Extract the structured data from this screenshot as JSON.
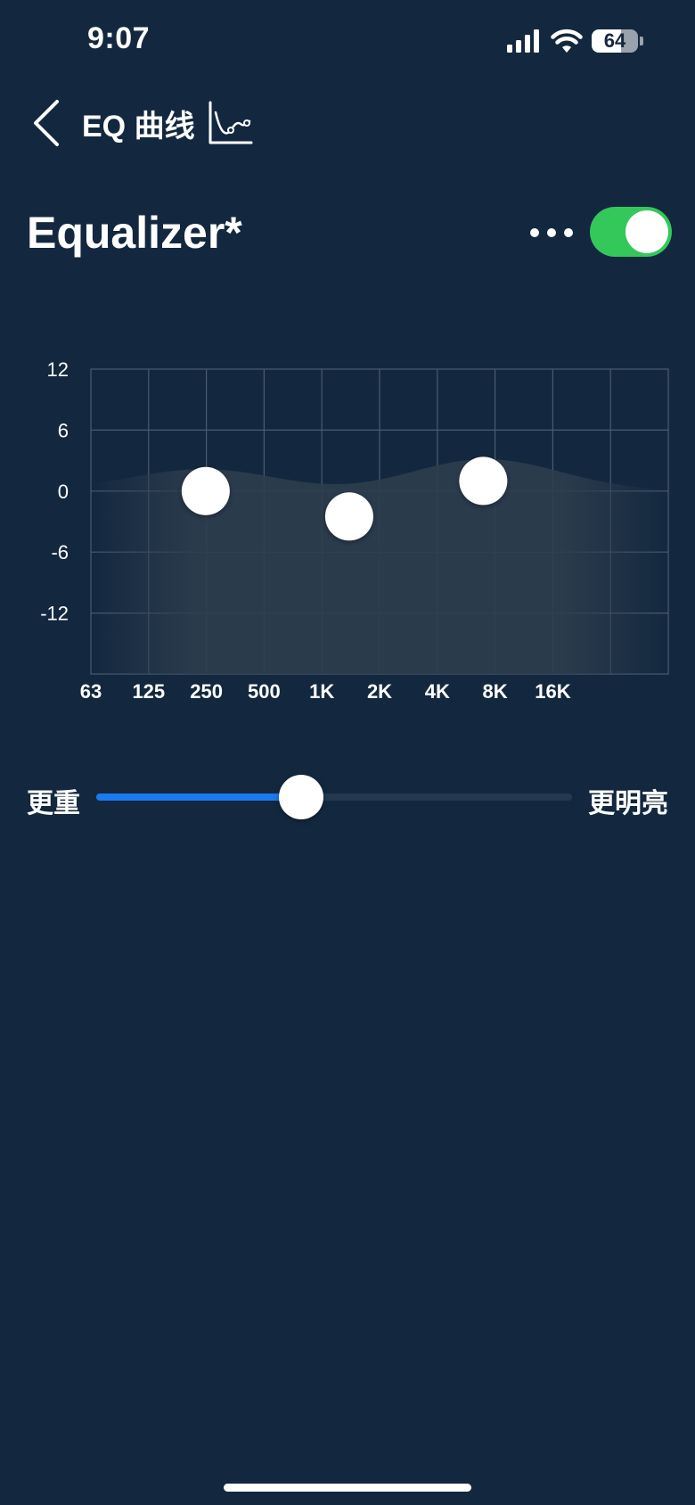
{
  "status_bar": {
    "time": "9:07",
    "battery_level": "64",
    "icons": [
      "cellular-signal-icon",
      "wifi-icon",
      "battery-icon"
    ]
  },
  "nav": {
    "back_icon": "chevron-left-icon",
    "title": "EQ 曲线",
    "curve_icon": "eq-curve-icon"
  },
  "header": {
    "title": "Equalizer*",
    "more_icon": "ellipsis-icon",
    "toggle_on": true
  },
  "chart_data": {
    "type": "line",
    "y_ticks": [
      "12",
      "6",
      "0",
      "-6",
      "-12"
    ],
    "ylim": [
      -18,
      12
    ],
    "x_labels": [
      "63",
      "125",
      "250",
      "500",
      "1K",
      "2K",
      "4K",
      "8K",
      "16K"
    ],
    "grid": true,
    "control_points": [
      {
        "freq_label": "250",
        "gain": 0
      },
      {
        "freq_label": "1.4K",
        "gain": -2.5
      },
      {
        "freq_label": "7K",
        "gain": 1
      }
    ]
  },
  "tone_slider": {
    "left_label": "更重",
    "right_label": "更明亮",
    "value_fraction": 0.43
  },
  "colors": {
    "background": "#13283f",
    "toggle_on": "#34c759",
    "slider_fill": "#1a7af0",
    "grid_line": "#4a5b70"
  }
}
